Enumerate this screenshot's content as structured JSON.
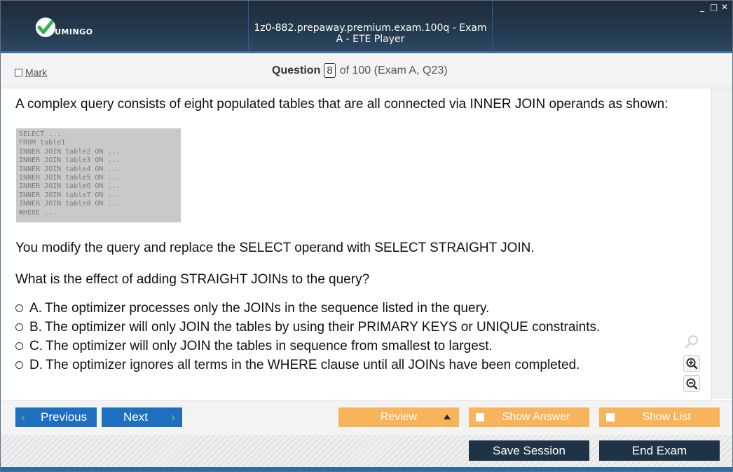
{
  "window": {
    "title": "1z0-882.prepaway.premium.exam.100q - Exam A - ETE Player",
    "logo_text": "UMINGO",
    "controls": {
      "minimize": "_",
      "maximize": "□",
      "close": "✕"
    }
  },
  "header": {
    "mark_label": "Mark",
    "question_label": "Question",
    "question_number": "8",
    "question_of": "of 100 (Exam A, Q23)"
  },
  "question": {
    "intro": "A complex query consists of eight populated tables that are all connected via INNER JOIN operands as shown:",
    "code_lines": [
      "SELECT ...",
      "FROM table1",
      "INNER JOIN table2 ON ...",
      "INNER JOIN table3 ON ...",
      "INNER JOIN table4 ON ...",
      "INNER JOIN table5 ON ...",
      "INNER JOIN table6 ON ...",
      "INNER JOIN table7 ON ...",
      "INNER JOIN table8 ON ...",
      "WHERE ..."
    ],
    "statement": "You modify the query and replace the SELECT operand with SELECT  STRAIGHT JOIN.",
    "ask": "What is the effect of adding STRAIGHT JOINs to the query?",
    "options": [
      {
        "letter": "A.",
        "text": "The optimizer processes only the JOINs in the sequence listed in the query."
      },
      {
        "letter": "B.",
        "text": "The optimizer will only JOIN the tables by using their PRIMARY KEYS or UNIQUE constraints."
      },
      {
        "letter": "C.",
        "text": "The optimizer will only JOIN the tables in sequence from smallest to largest."
      },
      {
        "letter": "D.",
        "text": "The optimizer ignores all terms in the WHERE clause until all JOINs have been completed."
      }
    ]
  },
  "nav": {
    "previous": "Previous",
    "next": "Next",
    "review": "Review",
    "show_answer": "Show Answer",
    "show_list": "Show List"
  },
  "footer": {
    "save_session": "Save Session",
    "end_exam": "End Exam"
  },
  "colors": {
    "title_bar": "#1d2b3c",
    "nav_blue": "#1f6fc0",
    "nav_orange": "#f7b45a",
    "footer_dark": "#1e3346",
    "logo_green": "#34b34a"
  },
  "icons": {
    "logo": "checkmark-logo-icon",
    "prev": "chevron-left-icon",
    "next": "chevron-right-icon",
    "review_menu": "triangle-up-icon",
    "zoom_reset": "magnifier-icon",
    "zoom_in": "zoom-in-icon",
    "zoom_out": "zoom-out-icon"
  }
}
